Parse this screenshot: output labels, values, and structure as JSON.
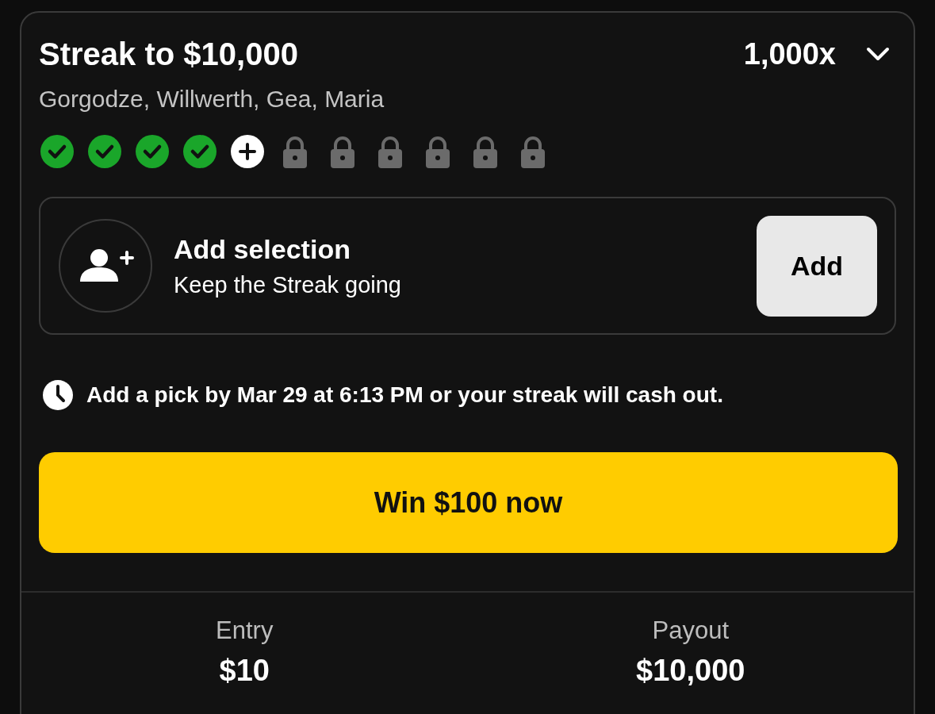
{
  "card": {
    "title": "Streak to $10,000",
    "multiplier": "1,000x",
    "expanded": false,
    "players": "Gorgodze, Willwerth, Gea, Maria",
    "legs": [
      {
        "kind": "done"
      },
      {
        "kind": "done"
      },
      {
        "kind": "done"
      },
      {
        "kind": "done"
      },
      {
        "kind": "current"
      },
      {
        "kind": "locked"
      },
      {
        "kind": "locked"
      },
      {
        "kind": "locked"
      },
      {
        "kind": "locked"
      },
      {
        "kind": "locked"
      },
      {
        "kind": "locked"
      }
    ],
    "selection": {
      "title": "Add selection",
      "subtitle": "Keep the Streak going",
      "button": "Add"
    },
    "deadline": "Add a pick by Mar 29 at 6:13 PM or your streak will cash out.",
    "cta": "Win $100 now",
    "stats": [
      {
        "label": "Entry",
        "value": "$10"
      },
      {
        "label": "Payout",
        "value": "$10,000"
      }
    ]
  }
}
